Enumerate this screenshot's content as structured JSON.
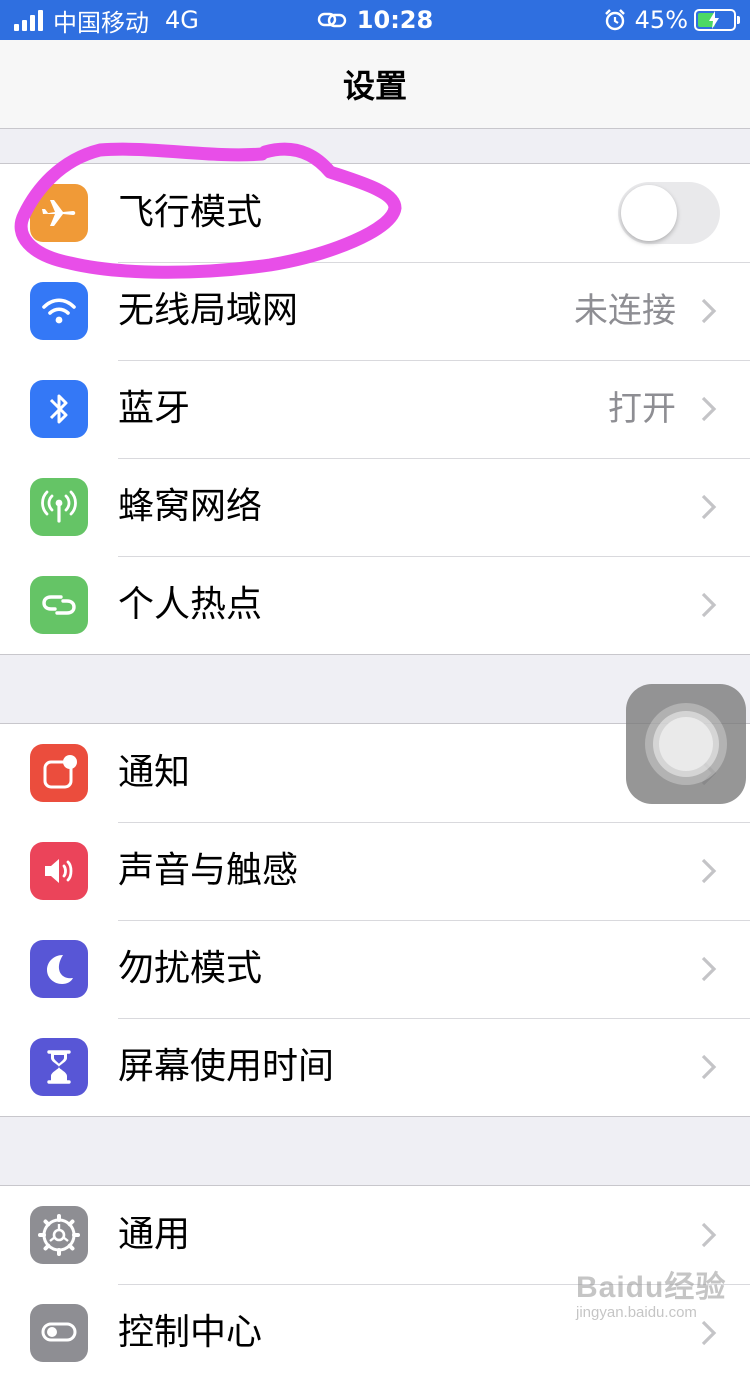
{
  "status_bar": {
    "carrier": "中国移动",
    "network": "4G",
    "time": "10:28",
    "battery": "45%",
    "battery_level": 0.45,
    "background_color": "#2f6fe0"
  },
  "nav": {
    "title": "设置"
  },
  "group1": [
    {
      "label": "飞行模式",
      "icon": "airplane-icon",
      "icon_color": "#f09a37",
      "control": "toggle",
      "toggle_on": false
    },
    {
      "label": "无线局域网",
      "icon": "wifi-icon",
      "icon_color": "#3478f6",
      "detail": "未连接"
    },
    {
      "label": "蓝牙",
      "icon": "bluetooth-icon",
      "icon_color": "#3478f6",
      "detail": "打开"
    },
    {
      "label": "蜂窝网络",
      "icon": "antenna-icon",
      "icon_color": "#65c466"
    },
    {
      "label": "个人热点",
      "icon": "hotspot-link-icon",
      "icon_color": "#65c466"
    }
  ],
  "group2": [
    {
      "label": "通知",
      "icon": "notification-icon",
      "icon_color": "#eb4d3d"
    },
    {
      "label": "声音与触感",
      "icon": "speaker-icon",
      "icon_color": "#eb445a"
    },
    {
      "label": "勿扰模式",
      "icon": "moon-icon",
      "icon_color": "#5856d6"
    },
    {
      "label": "屏幕使用时间",
      "icon": "hourglass-icon",
      "icon_color": "#5856d6"
    }
  ],
  "group3": [
    {
      "label": "通用",
      "icon": "gear-icon",
      "icon_color": "#8e8e93"
    },
    {
      "label": "控制中心",
      "icon": "switches-icon",
      "icon_color": "#8e8e93"
    }
  ],
  "annotation_color": "#e84ee8",
  "watermark": {
    "line1": "Baidu经验",
    "line2": "jingyan.baidu.com"
  }
}
